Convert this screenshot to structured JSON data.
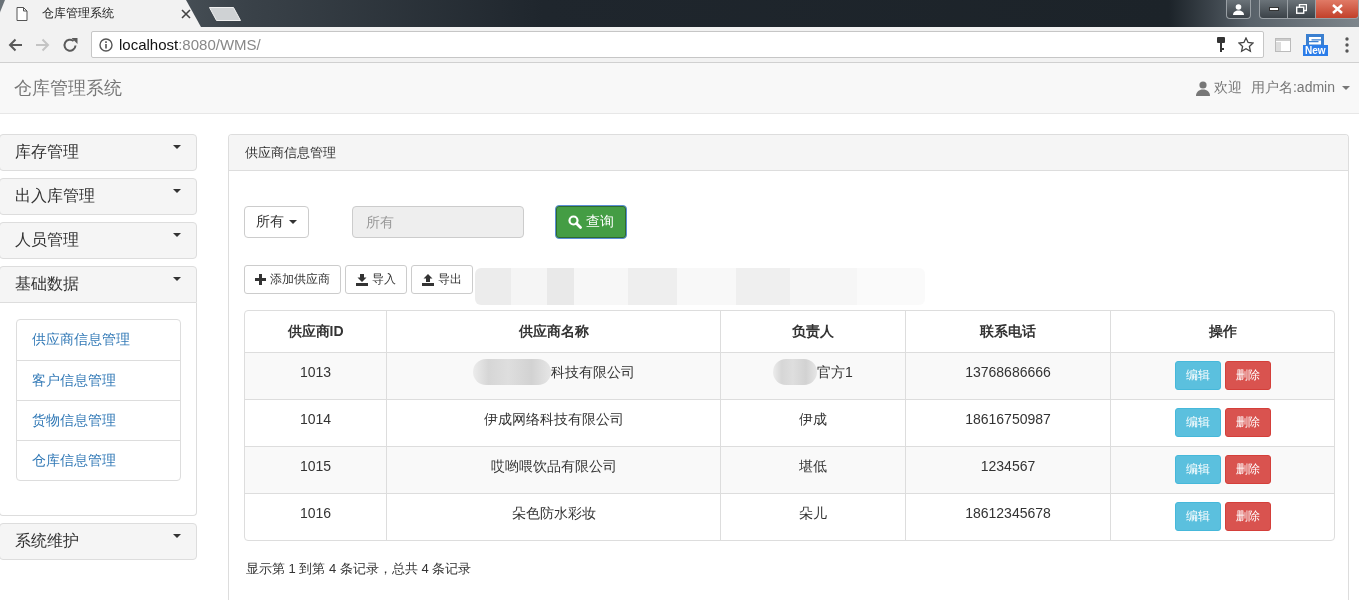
{
  "browser": {
    "tabs": [
      {
        "title": "仓库管理系统",
        "selected": true
      }
    ],
    "address": {
      "host": "localhost",
      "path": ":8080/WMS/"
    },
    "extension_badge": "New"
  },
  "navbar": {
    "brand": "仓库管理系统",
    "welcome": "欢迎",
    "user": "用户名:admin"
  },
  "sidebar": {
    "sections": [
      {
        "label": "库存管理",
        "expanded": false
      },
      {
        "label": "出入库管理",
        "expanded": false
      },
      {
        "label": "人员管理",
        "expanded": false
      },
      {
        "label": "基础数据",
        "expanded": true,
        "children": [
          {
            "label": "供应商信息管理"
          },
          {
            "label": "客户信息管理"
          },
          {
            "label": "货物信息管理"
          },
          {
            "label": "仓库信息管理"
          }
        ]
      },
      {
        "label": "系统维护",
        "expanded": false
      }
    ]
  },
  "panel": {
    "title": "供应商信息管理",
    "filter": {
      "dropdown": "所有",
      "placeholder": "所有",
      "disabled": true
    },
    "search_button": {
      "label": "查询",
      "focused": true
    },
    "toolbar": {
      "buttons": [
        {
          "label": "添加供应商",
          "kind": "add"
        },
        {
          "label": "导入",
          "kind": "import"
        },
        {
          "label": "导出",
          "kind": "export"
        }
      ],
      "redacted": true
    },
    "table": {
      "columns": [
        "供应商ID",
        "供应商名称",
        "负责人",
        "联系电话",
        "操作"
      ],
      "rows": [
        {
          "cells": [
            {
              "text": "1013",
              "redacted": false
            },
            {
              "text": "科技有限公司",
              "redacted": true
            },
            {
              "text": "官方1",
              "redacted": true
            },
            {
              "text": "13768686666",
              "redacted": false
            }
          ],
          "actions": [
            {
              "label": "编辑",
              "kind": "edit"
            },
            {
              "label": "删除",
              "kind": "delete"
            }
          ]
        },
        {
          "cells": [
            {
              "text": "1014",
              "redacted": false
            },
            {
              "text": "伊成网络科技有限公司",
              "redacted": false
            },
            {
              "text": "伊成",
              "redacted": false
            },
            {
              "text": "18616750987",
              "redacted": false
            }
          ],
          "actions": [
            {
              "label": "编辑",
              "kind": "edit"
            },
            {
              "label": "删除",
              "kind": "delete"
            }
          ]
        },
        {
          "cells": [
            {
              "text": "1015",
              "redacted": false
            },
            {
              "text": "哎哟喂饮品有限公司",
              "redacted": false
            },
            {
              "text": "堪低",
              "redacted": false
            },
            {
              "text": "1234567",
              "redacted": false
            }
          ],
          "actions": [
            {
              "label": "编辑",
              "kind": "edit"
            },
            {
              "label": "删除",
              "kind": "delete"
            }
          ]
        },
        {
          "cells": [
            {
              "text": "1016",
              "redacted": false
            },
            {
              "text": "朵色防水彩妆",
              "redacted": false
            },
            {
              "text": "朵儿",
              "redacted": false
            },
            {
              "text": "18612345678",
              "redacted": false
            }
          ],
          "actions": [
            {
              "label": "编辑",
              "kind": "edit"
            },
            {
              "label": "删除",
              "kind": "delete"
            }
          ]
        }
      ]
    },
    "summary": "显示第 1 到第 4 条记录，总共 4 条记录"
  }
}
